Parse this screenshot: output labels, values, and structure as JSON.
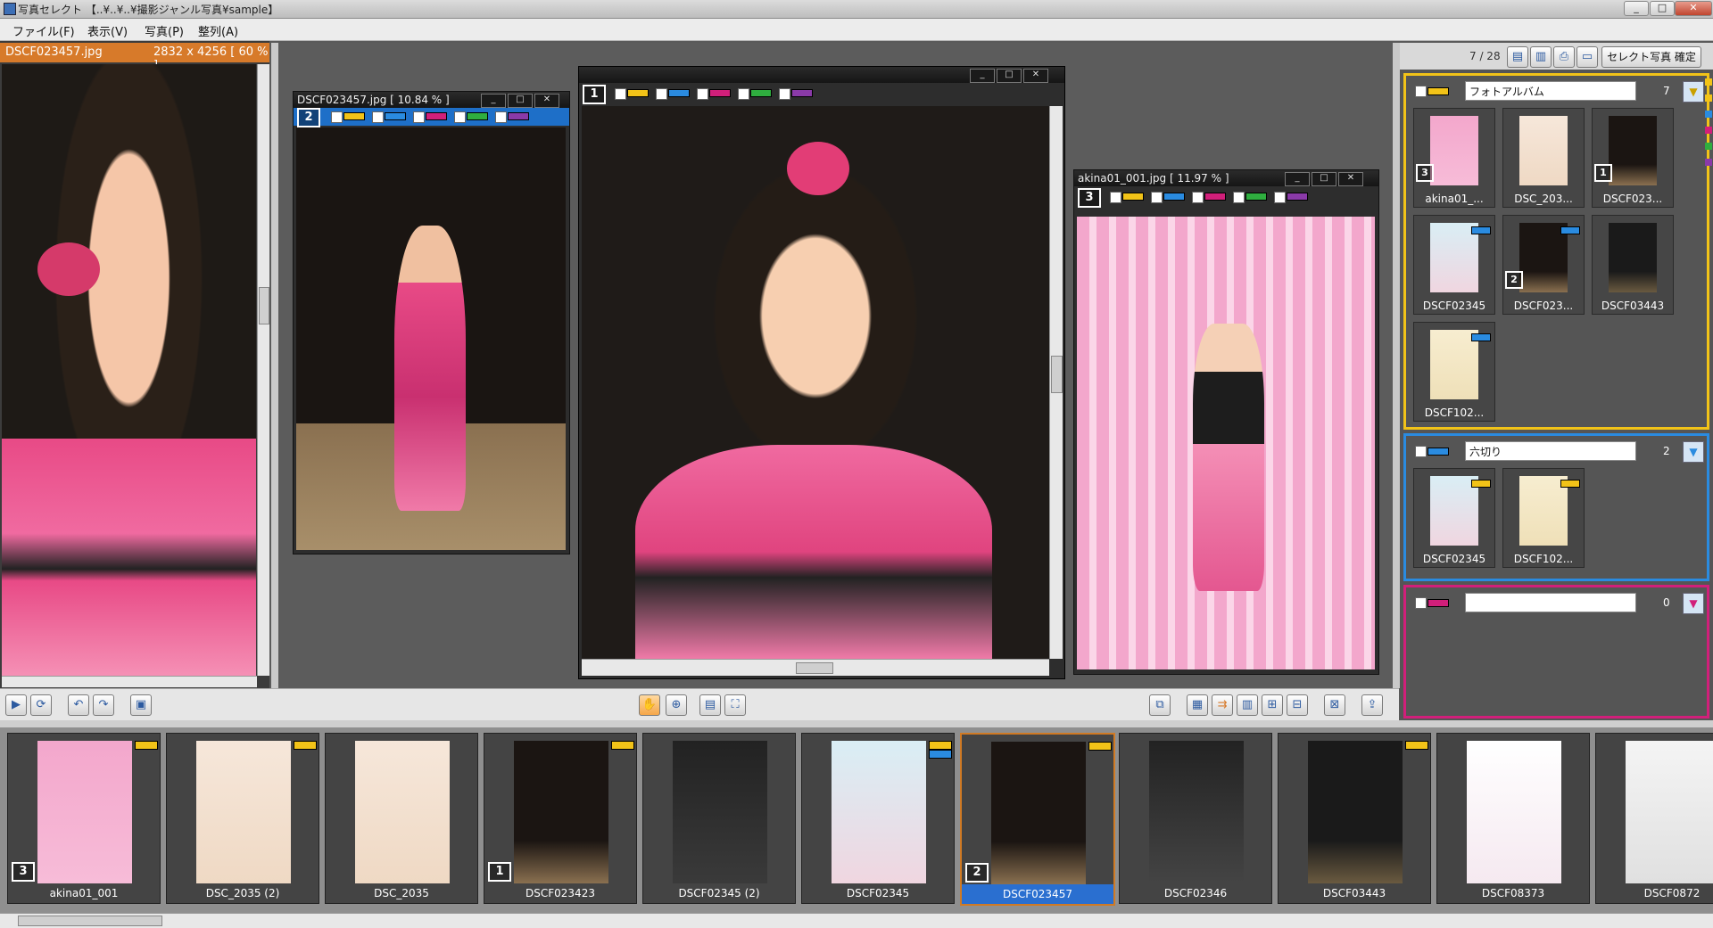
{
  "window": {
    "title": "写真セレクト 【..¥..¥..¥撮影ジャンル写真¥sample】",
    "min": "_",
    "max": "□",
    "close": "✕"
  },
  "menu": [
    "ファイル(F)",
    "表示(V)",
    "写真(P)",
    "整列(A)"
  ],
  "main_viewer": {
    "filename": "DSCF023457.jpg",
    "info": "2832 x 4256 [ 60 % ]"
  },
  "subwindows": [
    {
      "title": "DSCF023457.jpg [ 10.84 % ]",
      "badge": "2"
    },
    {
      "title": "",
      "badge": "1"
    },
    {
      "title": "akina01_001.jpg [ 11.97 % ]",
      "badge": "3"
    }
  ],
  "colors": {
    "yellow": "#f2c318",
    "blue": "#2a8be0",
    "magenta": "#d11f7a",
    "green": "#2fae3f",
    "purple": "#8a3aa8",
    "accent_orange": "#d77a2a",
    "select_blue": "#2a6fd0"
  },
  "right_panel": {
    "count": "7 / 28",
    "confirm_button": "セレクト写真 確定",
    "groups": [
      {
        "name": "フォトアルバム",
        "count": "7",
        "color": "#f2c318",
        "items": [
          {
            "label": "akina01_...",
            "badge": "3"
          },
          {
            "label": "DSC_203...",
            "badge": ""
          },
          {
            "label": "DSCF023...",
            "badge": "1"
          },
          {
            "label": "DSCF02345",
            "badge": ""
          },
          {
            "label": "DSCF023...",
            "badge": "2"
          },
          {
            "label": "DSCF03443",
            "badge": ""
          },
          {
            "label": "DSCF102...",
            "badge": ""
          }
        ]
      },
      {
        "name": "六切り",
        "count": "2",
        "color": "#2a8be0",
        "items": [
          {
            "label": "DSCF02345"
          },
          {
            "label": "DSCF102..."
          }
        ]
      },
      {
        "name": "",
        "count": "0",
        "color": "#d11f7a",
        "items": []
      }
    ]
  },
  "filmstrip": [
    {
      "label": "akina01_001",
      "badge": "3",
      "flags": [
        "yellow"
      ]
    },
    {
      "label": "DSC_2035 (2)",
      "badge": "",
      "flags": [
        "yellow"
      ]
    },
    {
      "label": "DSC_2035",
      "badge": "",
      "flags": []
    },
    {
      "label": "DSCF023423",
      "badge": "1",
      "flags": [
        "yellow"
      ]
    },
    {
      "label": "DSCF02345 (2)",
      "badge": "",
      "flags": []
    },
    {
      "label": "DSCF02345",
      "badge": "",
      "flags": [
        "yellow",
        "blue"
      ]
    },
    {
      "label": "DSCF023457",
      "badge": "2",
      "flags": [
        "yellow"
      ],
      "selected": true
    },
    {
      "label": "DSCF02346",
      "badge": "",
      "flags": []
    },
    {
      "label": "DSCF03443",
      "badge": "",
      "flags": [
        "yellow"
      ]
    },
    {
      "label": "DSCF08373",
      "badge": "",
      "flags": []
    },
    {
      "label": "DSCF0872",
      "badge": "",
      "flags": []
    }
  ]
}
